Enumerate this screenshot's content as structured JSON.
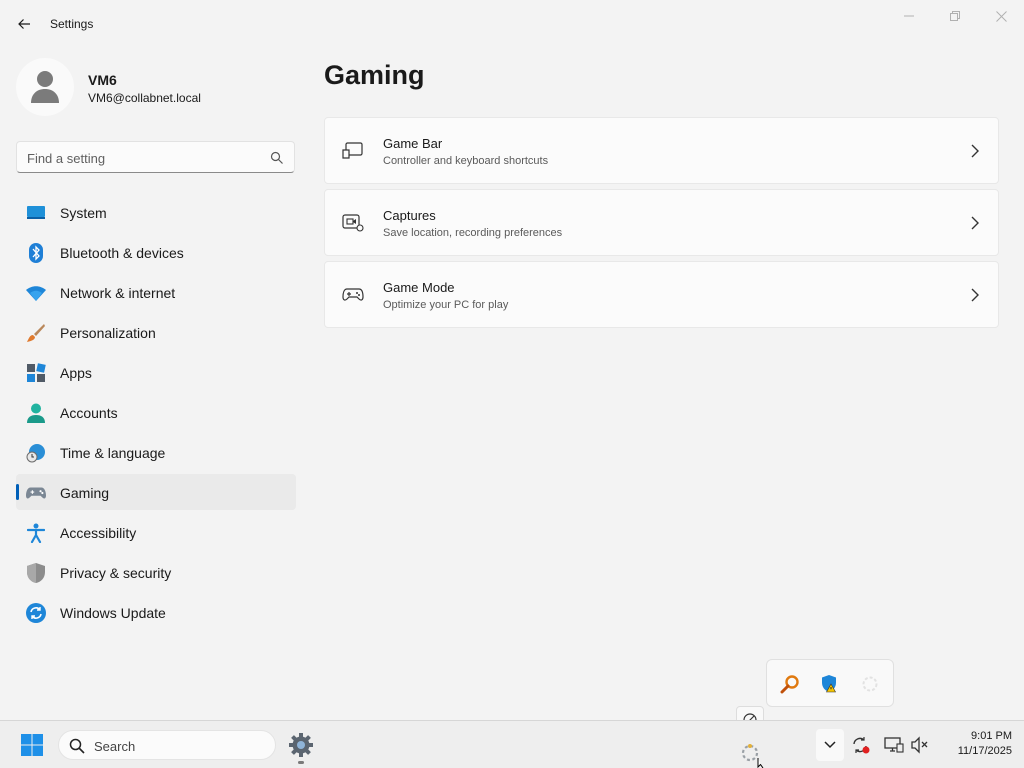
{
  "window": {
    "title": "Settings"
  },
  "profile": {
    "name": "VM6",
    "email": "VM6@collabnet.local"
  },
  "search": {
    "placeholder": "Find a setting"
  },
  "sidebar": {
    "items": [
      {
        "label": "System",
        "icon": "system-icon",
        "active": false
      },
      {
        "label": "Bluetooth & devices",
        "icon": "bluetooth-icon",
        "active": false
      },
      {
        "label": "Network & internet",
        "icon": "wifi-icon",
        "active": false
      },
      {
        "label": "Personalization",
        "icon": "brush-icon",
        "active": false
      },
      {
        "label": "Apps",
        "icon": "apps-icon",
        "active": false
      },
      {
        "label": "Accounts",
        "icon": "accounts-icon",
        "active": false
      },
      {
        "label": "Time & language",
        "icon": "globe-clock-icon",
        "active": false
      },
      {
        "label": "Gaming",
        "icon": "gamepad-icon",
        "active": true
      },
      {
        "label": "Accessibility",
        "icon": "accessibility-icon",
        "active": false
      },
      {
        "label": "Privacy & security",
        "icon": "shield-icon",
        "active": false
      },
      {
        "label": "Windows Update",
        "icon": "update-icon",
        "active": false
      }
    ]
  },
  "main": {
    "title": "Gaming",
    "cards": [
      {
        "title": "Game Bar",
        "description": "Controller and keyboard shortcuts",
        "icon": "game-bar-icon"
      },
      {
        "title": "Captures",
        "description": "Save location, recording preferences",
        "icon": "captures-icon"
      },
      {
        "title": "Game Mode",
        "description": "Optimize your PC for play",
        "icon": "game-mode-icon"
      }
    ]
  },
  "taskbar": {
    "search_label": "Search",
    "time": "9:01 PM",
    "date": "11/17/2025"
  },
  "colors": {
    "accent": "#005fb8",
    "background": "#f3f3f3",
    "card": "#fbfbfb"
  }
}
